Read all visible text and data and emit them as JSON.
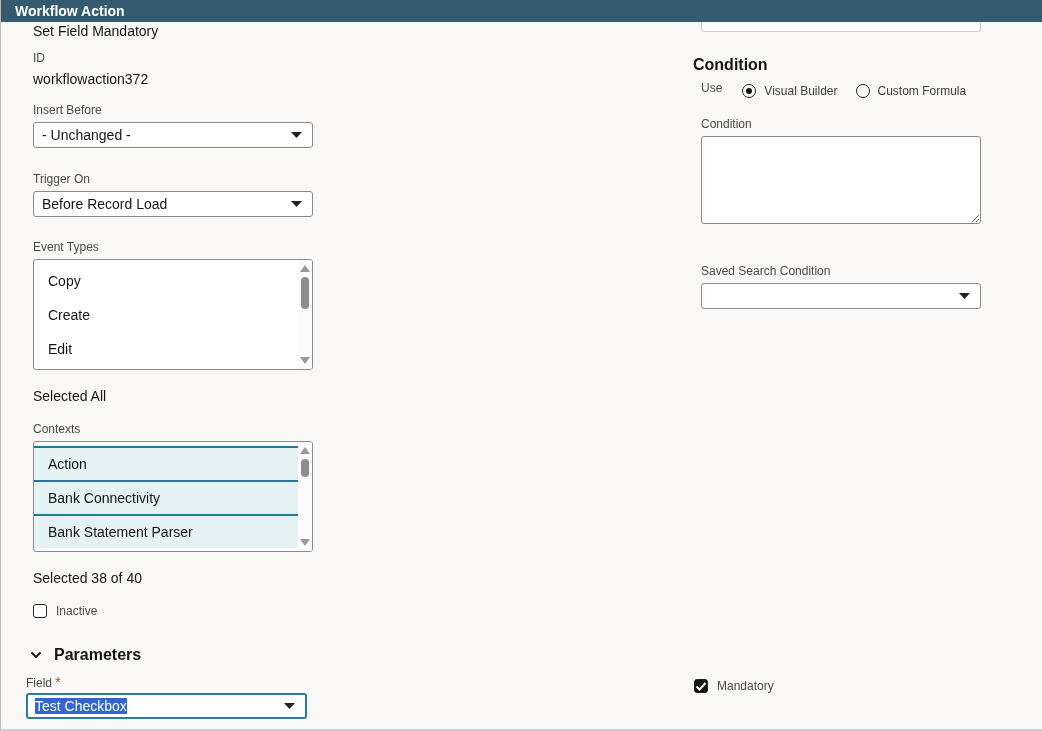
{
  "window": {
    "title": "Workflow Action"
  },
  "main": {
    "action_type": "Set Field Mandatory",
    "id": {
      "label": "ID",
      "value": "workflowaction372"
    },
    "insert_before": {
      "label": "Insert Before",
      "value": "- Unchanged -"
    },
    "trigger_on": {
      "label": "Trigger On",
      "value": "Before Record Load"
    },
    "event_types": {
      "label": "Event Types",
      "items": [
        {
          "label": "Copy",
          "selected": false
        },
        {
          "label": "Create",
          "selected": false
        },
        {
          "label": "Edit",
          "selected": false
        }
      ],
      "summary": "Selected All"
    },
    "contexts": {
      "label": "Contexts",
      "items": [
        {
          "label": "Action",
          "selected": true
        },
        {
          "label": "Bank Connectivity",
          "selected": true
        },
        {
          "label": "Bank Statement Parser",
          "selected": true
        }
      ],
      "summary": "Selected 38 of 40"
    },
    "inactive": {
      "label": "Inactive",
      "checked": false
    }
  },
  "condition": {
    "title": "Condition",
    "use_label": "Use",
    "options": [
      {
        "label": "Visual Builder",
        "selected": true
      },
      {
        "label": "Custom Formula",
        "selected": false
      }
    ],
    "condition_field": {
      "label": "Condition"
    },
    "saved_search": {
      "label": "Saved Search Condition"
    }
  },
  "parameters": {
    "title": "Parameters",
    "expanded": true,
    "field": {
      "label": "Field",
      "required_mark": "*",
      "value": "Test Checkbox",
      "focused": true
    },
    "mandatory": {
      "label": "Mandatory",
      "checked": true
    }
  }
}
